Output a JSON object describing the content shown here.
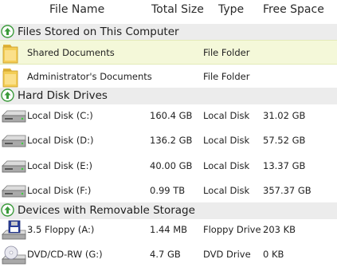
{
  "columns": {
    "name": "File Name",
    "size": "Total Size",
    "type": "Type",
    "free": "Free Space"
  },
  "groups": [
    {
      "title": "Files Stored on This Computer",
      "items": [
        {
          "name": "Shared Documents",
          "size": "",
          "type": "File Folder",
          "free": "",
          "icon": "folder-icon"
        },
        {
          "name": "Administrator's Documents",
          "size": "",
          "type": "File Folder",
          "free": "",
          "icon": "folder-icon"
        }
      ]
    },
    {
      "title": "Hard Disk Drives",
      "items": [
        {
          "name": "Local Disk (C:)",
          "size": "160.4 GB",
          "type": "Local Disk",
          "free": "31.02 GB",
          "icon": "hard-disk-icon"
        },
        {
          "name": "Local Disk (D:)",
          "size": "136.2 GB",
          "type": "Local Disk",
          "free": "57.52 GB",
          "icon": "hard-disk-icon"
        },
        {
          "name": "Local Disk (E:)",
          "size": "40.00 GB",
          "type": "Local Disk",
          "free": "13.37 GB",
          "icon": "hard-disk-icon"
        },
        {
          "name": "Local Disk (F:)",
          "size": "0.99 TB",
          "type": "Local Disk",
          "free": "357.37 GB",
          "icon": "hard-disk-icon"
        }
      ]
    },
    {
      "title": "Devices with Removable Storage",
      "items": [
        {
          "name": "3.5 Floppy (A:)",
          "size": "1.44 MB",
          "type": "Floppy Drive",
          "free": "203 KB",
          "icon": "floppy-drive-icon"
        },
        {
          "name": "DVD/CD-RW (G:)",
          "size": "4.7 GB",
          "type": "DVD Drive",
          "free": "0 KB",
          "icon": "dvd-drive-icon"
        }
      ]
    }
  ],
  "colors": {
    "group_band": "#ececec",
    "selected_row": "#f4f8d9",
    "collapse_arrow": "#3a9a3a"
  }
}
